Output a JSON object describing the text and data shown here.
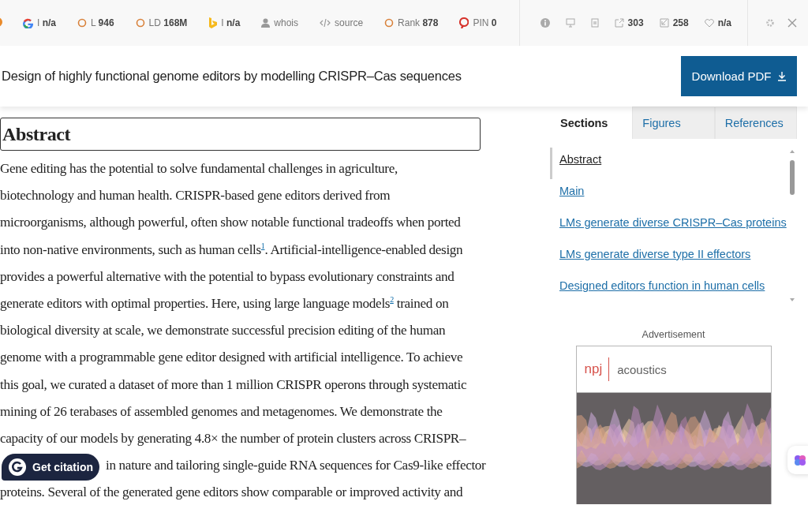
{
  "toolbar": {
    "items": [
      {
        "kind": "google",
        "label": "I",
        "value": "n/a"
      },
      {
        "kind": "circle",
        "label": "L",
        "value": "946"
      },
      {
        "kind": "circle",
        "label": "LD",
        "value": "168M"
      },
      {
        "kind": "bing",
        "label": "I",
        "value": "n/a"
      },
      {
        "kind": "person",
        "label": "whois"
      },
      {
        "kind": "code",
        "label": "source"
      },
      {
        "kind": "circle",
        "label": "Rank",
        "value": "878"
      },
      {
        "kind": "pin",
        "label": "PIN",
        "value": "0"
      }
    ],
    "stats": [
      {
        "kind": "info"
      },
      {
        "kind": "screen"
      },
      {
        "kind": "page"
      },
      {
        "kind": "out",
        "value": "303"
      },
      {
        "kind": "in",
        "value": "258"
      },
      {
        "kind": "heart",
        "value": "n/a"
      }
    ]
  },
  "header": {
    "title": "Design of highly functional genome editors by modelling CRISPR–Cas sequences",
    "button": "Download PDF"
  },
  "abstract": {
    "heading": "Abstract",
    "lines": [
      "Gene editing has the potential to solve fundamental challenges in agriculture,",
      "biotechnology and human health. CRISPR-based gene editors derived from",
      "microorganisms, although powerful, often show notable functional tradeoffs when ported",
      "into non-native environments, such as human cells$^{1}$. Artificial-intelligence-enabled design",
      "provides a powerful alternative with the potential to bypass evolutionary constraints and",
      "generate editors with optimal properties. Here, using large language models$^{2}$ trained on",
      "biological diversity at scale, we demonstrate successful precision editing of the human",
      "genome with a programmable gene editor designed with artificial intelligence. To achieve",
      "this goal, we curated a dataset of more than 1 million CRISPR operons through systematic",
      "mining of 26 terabases of assembled genomes and metagenomes. We demonstrate the",
      "capacity of our models by generating 4.8× the number of protein clusters across CRISPR–",
      "in nature and tailoring single-guide RNA sequences for Cas9-like effector",
      "proteins. Several of the generated gene editors show comparable or improved activity and"
    ]
  },
  "citation_button": "Get citation",
  "sidebar": {
    "tabs": [
      {
        "label": "Sections",
        "selected": true
      },
      {
        "label": "Figures",
        "selected": false
      },
      {
        "label": "References",
        "selected": false
      }
    ],
    "sections": [
      {
        "label": "Abstract",
        "selected": true
      },
      {
        "label": "Main",
        "selected": false
      },
      {
        "label": "LMs generate diverse CRISPR–Cas proteins",
        "selected": false
      },
      {
        "label": "LMs generate diverse type II effectors",
        "selected": false
      },
      {
        "label": "Designed editors function in human cells",
        "selected": false
      }
    ]
  },
  "ad": {
    "label": "Advertisement",
    "brand": "npj",
    "journal": "acoustics"
  }
}
